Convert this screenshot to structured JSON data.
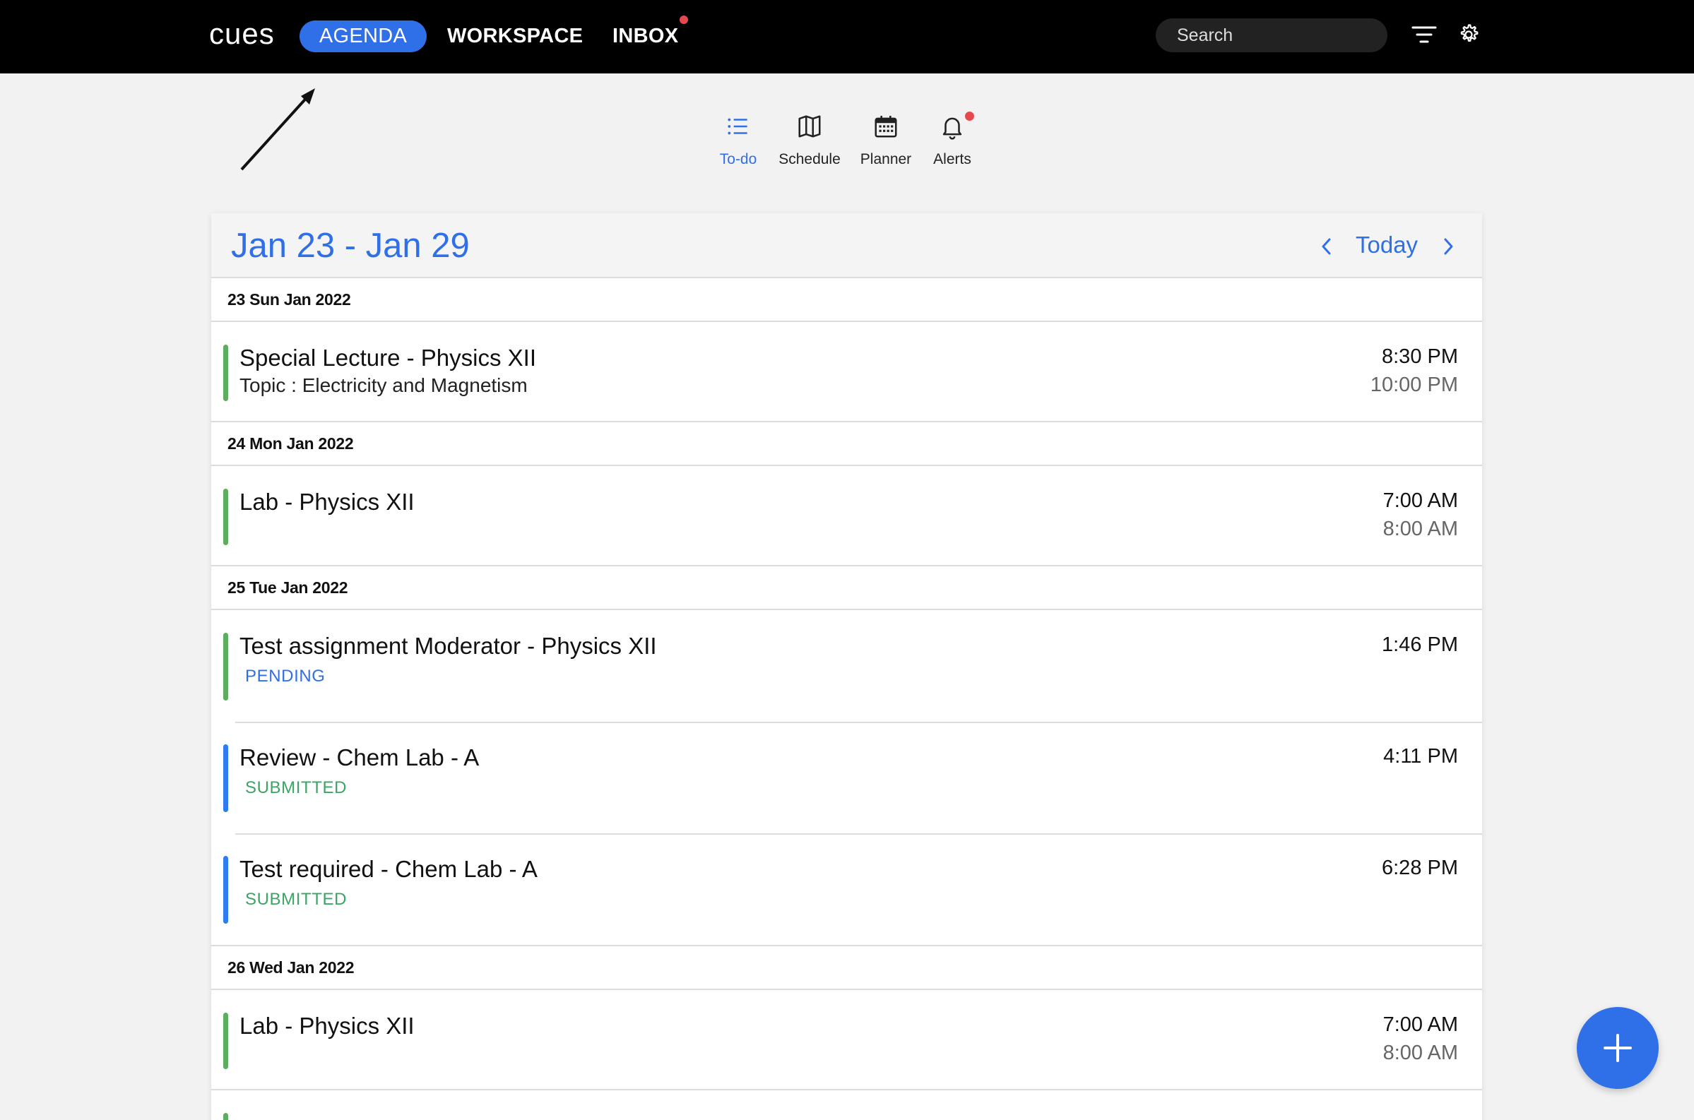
{
  "colors": {
    "accent": "#2f6fe8",
    "green_bar": "#5cad5f",
    "blue_bar": "#2f7cf0",
    "pending": "#2f6fe8",
    "submitted": "#3aa564",
    "notification_dot": "#e5484d"
  },
  "nav": {
    "logo": "cues",
    "tabs": [
      "AGENDA",
      "WORKSPACE",
      "INBOX"
    ],
    "active_tab": "AGENDA",
    "search_placeholder": "Search",
    "filter_icon": "filter-icon",
    "settings_icon": "gear-icon"
  },
  "views": [
    {
      "label": "To-do",
      "icon": "list-icon",
      "active": true
    },
    {
      "label": "Schedule",
      "icon": "map-icon",
      "active": false
    },
    {
      "label": "Planner",
      "icon": "calendar-icon",
      "active": false
    },
    {
      "label": "Alerts",
      "icon": "bell-icon",
      "active": false
    }
  ],
  "agenda": {
    "range": "Jan 23 - Jan 29",
    "today_label": "Today",
    "days": [
      {
        "date": "23 Sun Jan 2022",
        "events": [
          {
            "title": "Special Lecture - Physics XII",
            "subtitle": "Topic : Electricity and Magnetism",
            "start": "8:30 PM",
            "end": "10:00 PM",
            "color": "green"
          }
        ]
      },
      {
        "date": "24 Mon Jan 2022",
        "events": [
          {
            "title": "Lab - Physics XII",
            "start": "7:00 AM",
            "end": "8:00 AM",
            "color": "green"
          }
        ]
      },
      {
        "date": "25 Tue Jan 2022",
        "events": [
          {
            "title": "Test assignment Moderator - Physics XII",
            "status": "PENDING",
            "start": "1:46 PM",
            "color": "green"
          },
          {
            "title": "Review - Chem Lab - A",
            "status": "SUBMITTED",
            "start": "4:11 PM",
            "color": "blue"
          },
          {
            "title": "Test required - Chem Lab - A",
            "status": "SUBMITTED",
            "start": "6:28 PM",
            "color": "blue"
          }
        ]
      },
      {
        "date": "26 Wed Jan 2022",
        "events": [
          {
            "title": "Lab - Physics XII",
            "start": "7:00 AM",
            "end": "8:00 AM",
            "color": "green"
          }
        ]
      }
    ]
  },
  "fab_icon": "plus-icon"
}
